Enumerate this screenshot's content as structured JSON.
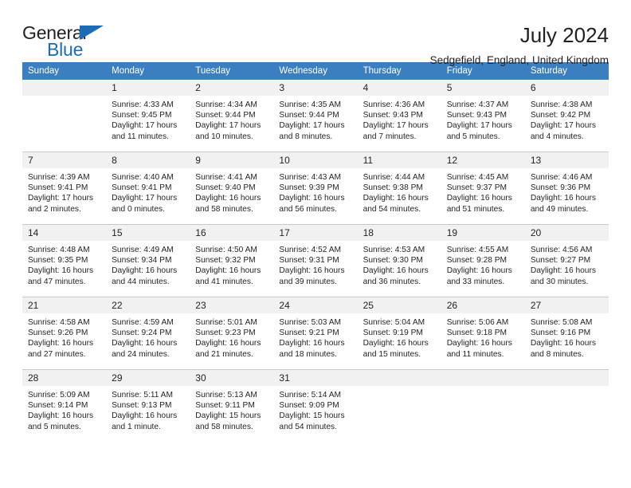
{
  "brand": {
    "name_part1": "General",
    "name_part2": "Blue",
    "accent_color": "#1b6cb5"
  },
  "header": {
    "title": "July 2024",
    "subtitle": "Sedgefield, England, United Kingdom",
    "header_bg_color": "#3c7fc1",
    "daynum_bg_color": "#f1f1f1"
  },
  "weekdays": [
    "Sunday",
    "Monday",
    "Tuesday",
    "Wednesday",
    "Thursday",
    "Friday",
    "Saturday"
  ],
  "labels": {
    "sunrise_prefix": "Sunrise: ",
    "sunset_prefix": "Sunset: ",
    "daylight_prefix": "Daylight: "
  },
  "weeks": [
    [
      {
        "day": "",
        "sunrise": "",
        "sunset": "",
        "daylight_line1": "",
        "daylight_line2": ""
      },
      {
        "day": "1",
        "sunrise": "Sunrise: 4:33 AM",
        "sunset": "Sunset: 9:45 PM",
        "daylight_line1": "Daylight: 17 hours",
        "daylight_line2": "and 11 minutes."
      },
      {
        "day": "2",
        "sunrise": "Sunrise: 4:34 AM",
        "sunset": "Sunset: 9:44 PM",
        "daylight_line1": "Daylight: 17 hours",
        "daylight_line2": "and 10 minutes."
      },
      {
        "day": "3",
        "sunrise": "Sunrise: 4:35 AM",
        "sunset": "Sunset: 9:44 PM",
        "daylight_line1": "Daylight: 17 hours",
        "daylight_line2": "and 8 minutes."
      },
      {
        "day": "4",
        "sunrise": "Sunrise: 4:36 AM",
        "sunset": "Sunset: 9:43 PM",
        "daylight_line1": "Daylight: 17 hours",
        "daylight_line2": "and 7 minutes."
      },
      {
        "day": "5",
        "sunrise": "Sunrise: 4:37 AM",
        "sunset": "Sunset: 9:43 PM",
        "daylight_line1": "Daylight: 17 hours",
        "daylight_line2": "and 5 minutes."
      },
      {
        "day": "6",
        "sunrise": "Sunrise: 4:38 AM",
        "sunset": "Sunset: 9:42 PM",
        "daylight_line1": "Daylight: 17 hours",
        "daylight_line2": "and 4 minutes."
      }
    ],
    [
      {
        "day": "7",
        "sunrise": "Sunrise: 4:39 AM",
        "sunset": "Sunset: 9:41 PM",
        "daylight_line1": "Daylight: 17 hours",
        "daylight_line2": "and 2 minutes."
      },
      {
        "day": "8",
        "sunrise": "Sunrise: 4:40 AM",
        "sunset": "Sunset: 9:41 PM",
        "daylight_line1": "Daylight: 17 hours",
        "daylight_line2": "and 0 minutes."
      },
      {
        "day": "9",
        "sunrise": "Sunrise: 4:41 AM",
        "sunset": "Sunset: 9:40 PM",
        "daylight_line1": "Daylight: 16 hours",
        "daylight_line2": "and 58 minutes."
      },
      {
        "day": "10",
        "sunrise": "Sunrise: 4:43 AM",
        "sunset": "Sunset: 9:39 PM",
        "daylight_line1": "Daylight: 16 hours",
        "daylight_line2": "and 56 minutes."
      },
      {
        "day": "11",
        "sunrise": "Sunrise: 4:44 AM",
        "sunset": "Sunset: 9:38 PM",
        "daylight_line1": "Daylight: 16 hours",
        "daylight_line2": "and 54 minutes."
      },
      {
        "day": "12",
        "sunrise": "Sunrise: 4:45 AM",
        "sunset": "Sunset: 9:37 PM",
        "daylight_line1": "Daylight: 16 hours",
        "daylight_line2": "and 51 minutes."
      },
      {
        "day": "13",
        "sunrise": "Sunrise: 4:46 AM",
        "sunset": "Sunset: 9:36 PM",
        "daylight_line1": "Daylight: 16 hours",
        "daylight_line2": "and 49 minutes."
      }
    ],
    [
      {
        "day": "14",
        "sunrise": "Sunrise: 4:48 AM",
        "sunset": "Sunset: 9:35 PM",
        "daylight_line1": "Daylight: 16 hours",
        "daylight_line2": "and 47 minutes."
      },
      {
        "day": "15",
        "sunrise": "Sunrise: 4:49 AM",
        "sunset": "Sunset: 9:34 PM",
        "daylight_line1": "Daylight: 16 hours",
        "daylight_line2": "and 44 minutes."
      },
      {
        "day": "16",
        "sunrise": "Sunrise: 4:50 AM",
        "sunset": "Sunset: 9:32 PM",
        "daylight_line1": "Daylight: 16 hours",
        "daylight_line2": "and 41 minutes."
      },
      {
        "day": "17",
        "sunrise": "Sunrise: 4:52 AM",
        "sunset": "Sunset: 9:31 PM",
        "daylight_line1": "Daylight: 16 hours",
        "daylight_line2": "and 39 minutes."
      },
      {
        "day": "18",
        "sunrise": "Sunrise: 4:53 AM",
        "sunset": "Sunset: 9:30 PM",
        "daylight_line1": "Daylight: 16 hours",
        "daylight_line2": "and 36 minutes."
      },
      {
        "day": "19",
        "sunrise": "Sunrise: 4:55 AM",
        "sunset": "Sunset: 9:28 PM",
        "daylight_line1": "Daylight: 16 hours",
        "daylight_line2": "and 33 minutes."
      },
      {
        "day": "20",
        "sunrise": "Sunrise: 4:56 AM",
        "sunset": "Sunset: 9:27 PM",
        "daylight_line1": "Daylight: 16 hours",
        "daylight_line2": "and 30 minutes."
      }
    ],
    [
      {
        "day": "21",
        "sunrise": "Sunrise: 4:58 AM",
        "sunset": "Sunset: 9:26 PM",
        "daylight_line1": "Daylight: 16 hours",
        "daylight_line2": "and 27 minutes."
      },
      {
        "day": "22",
        "sunrise": "Sunrise: 4:59 AM",
        "sunset": "Sunset: 9:24 PM",
        "daylight_line1": "Daylight: 16 hours",
        "daylight_line2": "and 24 minutes."
      },
      {
        "day": "23",
        "sunrise": "Sunrise: 5:01 AM",
        "sunset": "Sunset: 9:23 PM",
        "daylight_line1": "Daylight: 16 hours",
        "daylight_line2": "and 21 minutes."
      },
      {
        "day": "24",
        "sunrise": "Sunrise: 5:03 AM",
        "sunset": "Sunset: 9:21 PM",
        "daylight_line1": "Daylight: 16 hours",
        "daylight_line2": "and 18 minutes."
      },
      {
        "day": "25",
        "sunrise": "Sunrise: 5:04 AM",
        "sunset": "Sunset: 9:19 PM",
        "daylight_line1": "Daylight: 16 hours",
        "daylight_line2": "and 15 minutes."
      },
      {
        "day": "26",
        "sunrise": "Sunrise: 5:06 AM",
        "sunset": "Sunset: 9:18 PM",
        "daylight_line1": "Daylight: 16 hours",
        "daylight_line2": "and 11 minutes."
      },
      {
        "day": "27",
        "sunrise": "Sunrise: 5:08 AM",
        "sunset": "Sunset: 9:16 PM",
        "daylight_line1": "Daylight: 16 hours",
        "daylight_line2": "and 8 minutes."
      }
    ],
    [
      {
        "day": "28",
        "sunrise": "Sunrise: 5:09 AM",
        "sunset": "Sunset: 9:14 PM",
        "daylight_line1": "Daylight: 16 hours",
        "daylight_line2": "and 5 minutes."
      },
      {
        "day": "29",
        "sunrise": "Sunrise: 5:11 AM",
        "sunset": "Sunset: 9:13 PM",
        "daylight_line1": "Daylight: 16 hours",
        "daylight_line2": "and 1 minute."
      },
      {
        "day": "30",
        "sunrise": "Sunrise: 5:13 AM",
        "sunset": "Sunset: 9:11 PM",
        "daylight_line1": "Daylight: 15 hours",
        "daylight_line2": "and 58 minutes."
      },
      {
        "day": "31",
        "sunrise": "Sunrise: 5:14 AM",
        "sunset": "Sunset: 9:09 PM",
        "daylight_line1": "Daylight: 15 hours",
        "daylight_line2": "and 54 minutes."
      },
      {
        "day": "",
        "sunrise": "",
        "sunset": "",
        "daylight_line1": "",
        "daylight_line2": ""
      },
      {
        "day": "",
        "sunrise": "",
        "sunset": "",
        "daylight_line1": "",
        "daylight_line2": ""
      },
      {
        "day": "",
        "sunrise": "",
        "sunset": "",
        "daylight_line1": "",
        "daylight_line2": ""
      }
    ]
  ]
}
